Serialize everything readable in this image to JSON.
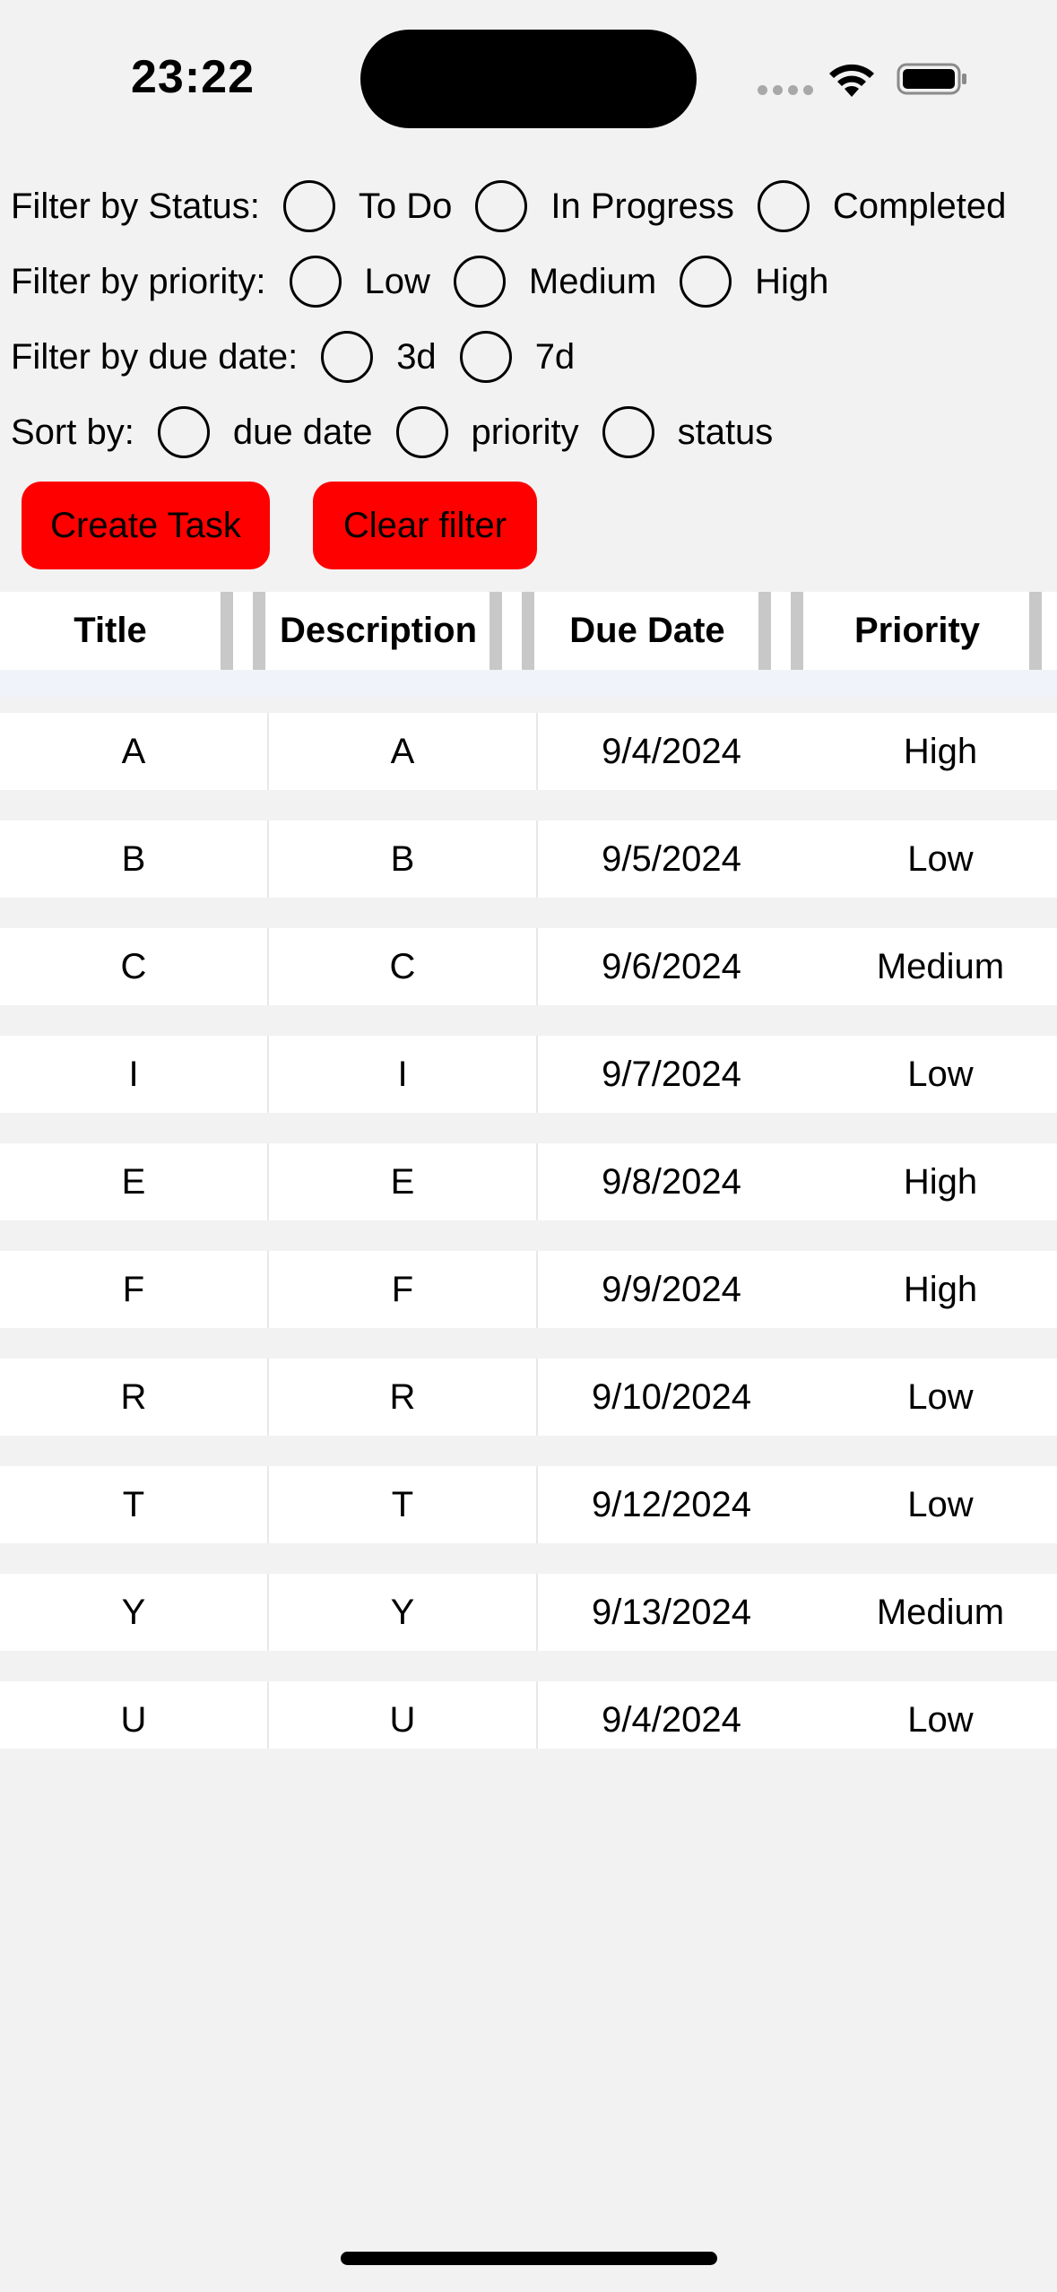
{
  "status_bar": {
    "time": "23:22"
  },
  "filters": {
    "status": {
      "label": "Filter by Status:",
      "options": [
        "To Do",
        "In Progress",
        "Completed"
      ]
    },
    "priority": {
      "label": "Filter by priority:",
      "options": [
        "Low",
        "Medium",
        "High"
      ]
    },
    "due_date": {
      "label": "Filter by due date:",
      "options": [
        "3d",
        "7d"
      ]
    },
    "sort": {
      "label": "Sort by:",
      "options": [
        "due date",
        "priority",
        "status"
      ]
    }
  },
  "buttons": {
    "create_task": "Create Task",
    "clear_filter": "Clear filter"
  },
  "accent_color": "#ff0000",
  "table": {
    "columns": [
      "Title",
      "Description",
      "Due Date",
      "Priority"
    ],
    "rows": [
      [
        "A",
        "A",
        "9/4/2024",
        "High"
      ],
      [
        "B",
        "B",
        "9/5/2024",
        "Low"
      ],
      [
        "C",
        "C",
        "9/6/2024",
        "Medium"
      ],
      [
        "I",
        "I",
        "9/7/2024",
        "Low"
      ],
      [
        "E",
        "E",
        "9/8/2024",
        "High"
      ],
      [
        "F",
        "F",
        "9/9/2024",
        "High"
      ],
      [
        "R",
        "R",
        "9/10/2024",
        "Low"
      ],
      [
        "T",
        "T",
        "9/12/2024",
        "Low"
      ],
      [
        "Y",
        "Y",
        "9/13/2024",
        "Medium"
      ],
      [
        "U",
        "U",
        "9/4/2024",
        "Low"
      ]
    ]
  }
}
